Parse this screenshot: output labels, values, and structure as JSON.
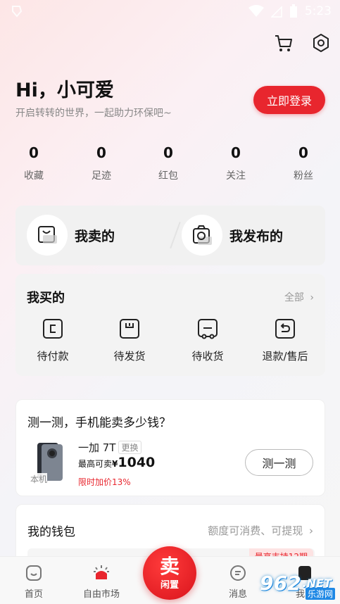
{
  "status": {
    "time": "5:23"
  },
  "header": {
    "cart_icon": "cart-icon",
    "settings_icon": "settings-icon"
  },
  "profile": {
    "greeting": "Hi，小可爱",
    "subtitle": "开启转转的世界，一起助力环保吧~",
    "login_label": "立即登录"
  },
  "stats": [
    {
      "value": "0",
      "label": "收藏"
    },
    {
      "value": "0",
      "label": "足迹"
    },
    {
      "value": "0",
      "label": "红包"
    },
    {
      "value": "0",
      "label": "关注"
    },
    {
      "value": "0",
      "label": "粉丝"
    }
  ],
  "sell_section": {
    "my_sold": "我卖的",
    "my_published": "我发布的"
  },
  "buy_section": {
    "title": "我买的",
    "all_label": "全部",
    "items": [
      {
        "label": "待付款",
        "icon": "pending-payment-icon"
      },
      {
        "label": "待发货",
        "icon": "pending-shipment-icon"
      },
      {
        "label": "待收货",
        "icon": "pending-receipt-icon"
      },
      {
        "label": "退款/售后",
        "icon": "refund-icon"
      }
    ]
  },
  "phone_test": {
    "title": "测一测，手机能卖多少钱？",
    "model": "一加 7T",
    "change_label": "更换",
    "device_tag": "本机",
    "price_label": "最高可卖",
    "currency": "¥",
    "price": "1040",
    "discount": "限时加价13%",
    "button_label": "测一测"
  },
  "wallet": {
    "title": "我的钱包",
    "subtitle": "额度可消费、可提现",
    "badge": "最高支持12期"
  },
  "tabbar": {
    "home": "首页",
    "market": "自由市场",
    "sell_big": "卖",
    "sell_small": "闲置",
    "messages": "消息",
    "mine": "我的"
  },
  "watermark": {
    "logo": "962",
    "text": "乐游网",
    "suffix": ".NET"
  },
  "colors": {
    "accent": "#e8262e",
    "background": "#f6f6f6"
  }
}
